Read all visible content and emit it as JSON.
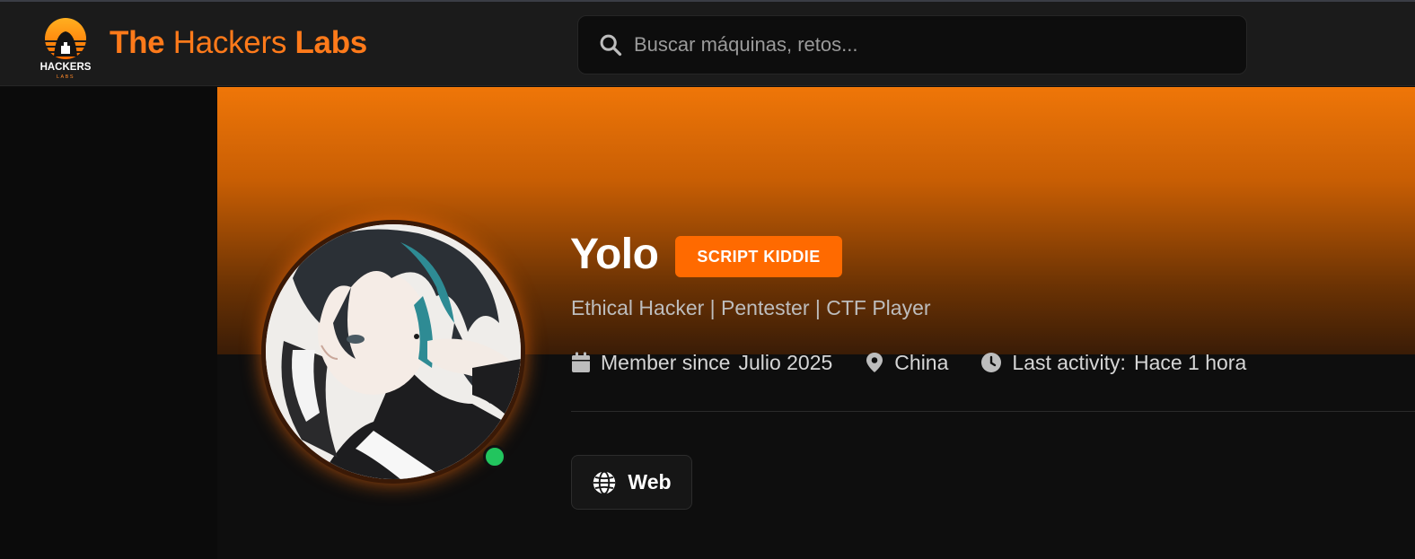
{
  "header": {
    "brand_part1": "The",
    "brand_part2": "Hackers",
    "brand_part3": "Labs",
    "logo_text": "HACKERS",
    "logo_sub": "LABS",
    "search_placeholder": "Buscar máquinas, retos..."
  },
  "profile": {
    "username": "Yolo",
    "rank": "SCRIPT KIDDIE",
    "bio": "Ethical Hacker | Pentester | CTF Player",
    "member_since_label": "Member since",
    "member_since_value": "Julio 2025",
    "location": "China",
    "last_activity_label": "Last activity:",
    "last_activity_value": "Hace 1 hora",
    "online": true
  },
  "links": {
    "web_label": "Web"
  },
  "colors": {
    "accent": "#ff6a00",
    "brand": "#ff7a1a",
    "online": "#22c55e",
    "background": "#0e0e0e"
  },
  "icons": [
    "search-icon",
    "calendar-icon",
    "location-pin-icon",
    "clock-icon",
    "globe-icon"
  ]
}
